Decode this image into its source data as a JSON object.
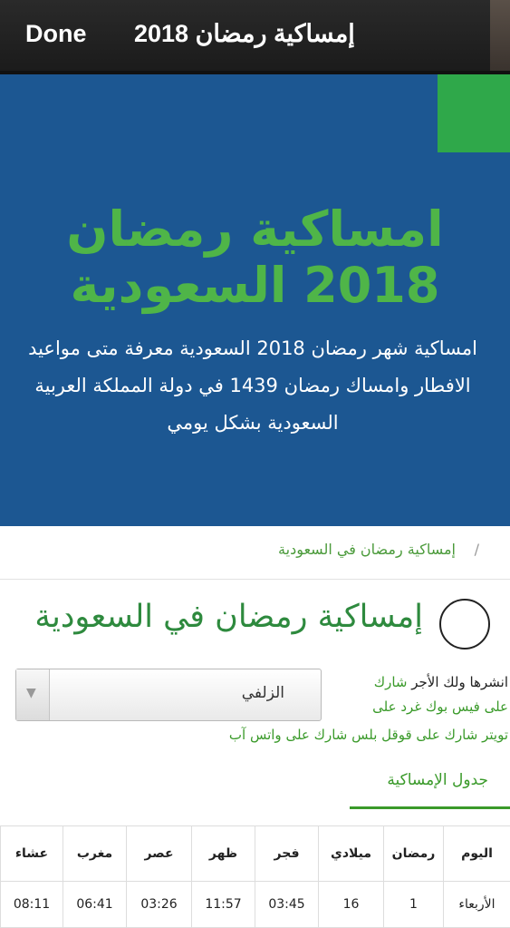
{
  "topbar": {
    "done_label": "Done",
    "title": "إمساكية رمضان 2018"
  },
  "hero": {
    "title_line1": "امساكية رمضان",
    "title_line2": "2018 السعودية",
    "description": "امساكية شهر رمضان 2018 السعودية معرفة متى مواعيد الافطار وامساك رمضان 1439 في دولة المملكة العربية السعودية بشكل يومي",
    "accent_color": "#2fa84a",
    "background_color": "#1c5792"
  },
  "breadcrumb": {
    "separator": "/",
    "link": "إمساكية رمضان في السعودية"
  },
  "page_title": "إمساكية رمضان في السعودية",
  "city_select": {
    "value": "الزلفي",
    "arrow_icon": "triangle-down"
  },
  "share": {
    "line1_prefix": "انشرها ولك الأجر ",
    "line1_link": "شارك",
    "line2": "على فيس بوك غرد على",
    "line3": "تويتر شارك على قوقل بلس شارك على واتس آب"
  },
  "tab": {
    "label": "جدول الإمساكية"
  },
  "table": {
    "headers": [
      "اليوم",
      "رمضان",
      "ميلادي",
      "فجر",
      "ظهر",
      "عصر",
      "مغرب",
      "عشاء"
    ],
    "rows": [
      [
        "الأربعاء",
        "1",
        "16",
        "03:45",
        "11:57",
        "03:26",
        "06:41",
        "08:11"
      ]
    ]
  }
}
